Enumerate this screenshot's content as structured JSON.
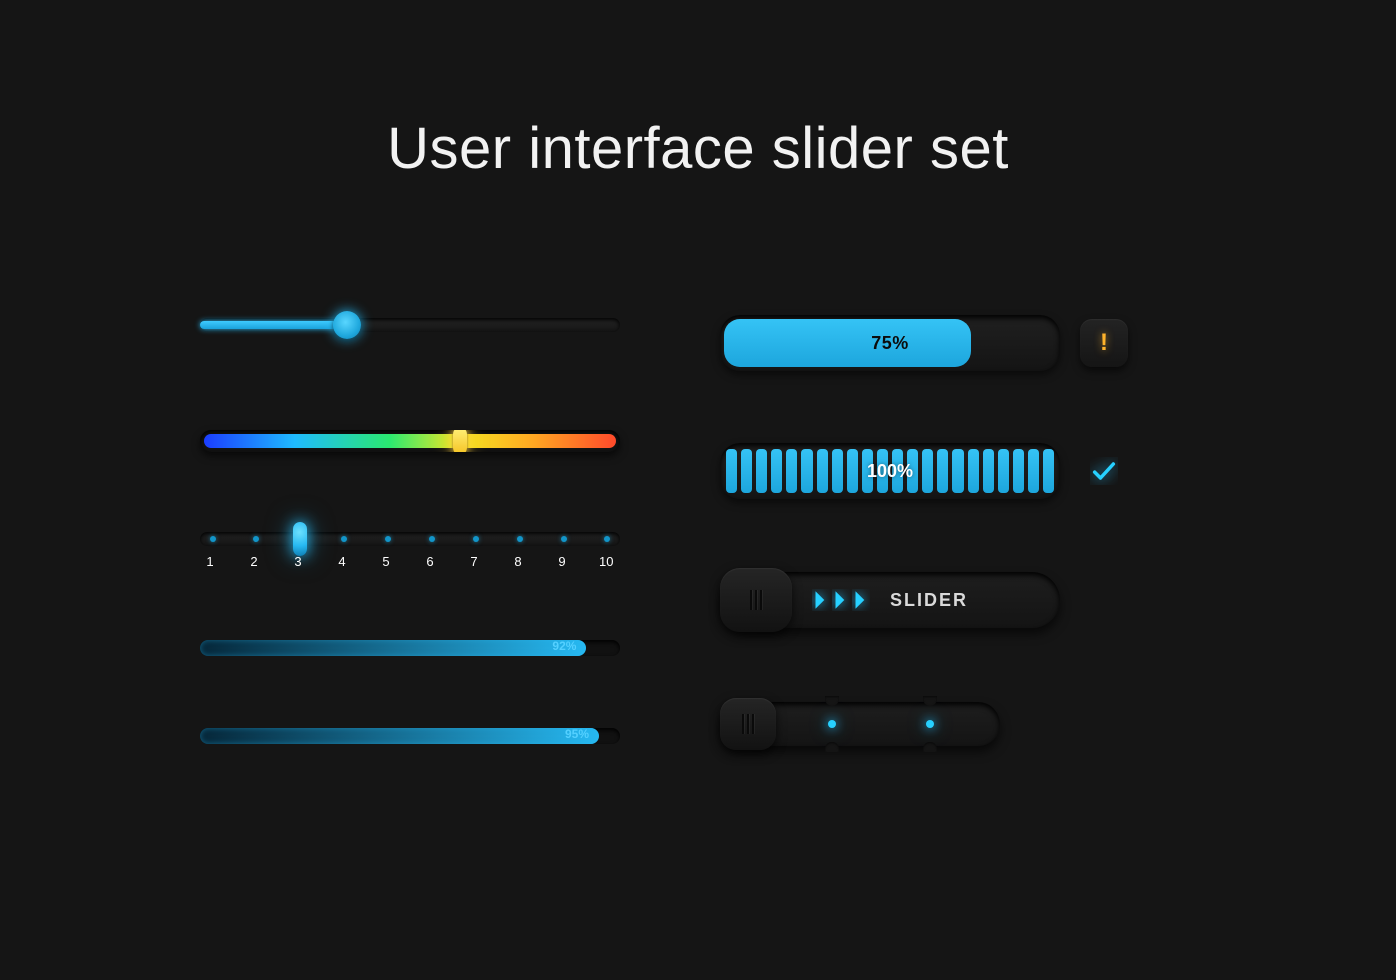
{
  "title": "User interface slider set",
  "colors": {
    "accent": "#27B9F2",
    "warning": "#FFB32B",
    "bg": "#151515"
  },
  "basic_slider": {
    "percent": 35
  },
  "rainbow_slider": {
    "percent": 62
  },
  "step_slider": {
    "steps": [
      "1",
      "2",
      "3",
      "4",
      "5",
      "6",
      "7",
      "8",
      "9",
      "10"
    ],
    "selected_index": 2
  },
  "thin_progress_a": {
    "percent": 92,
    "label": "92%"
  },
  "thin_progress_b": {
    "percent": 95,
    "label": "95%"
  },
  "progress_block": {
    "percent": 75,
    "label": "75%",
    "status_icon": "warning-icon"
  },
  "stripe_block": {
    "percent": 100,
    "label": "100%",
    "segments": 22,
    "status_icon": "check-icon"
  },
  "pull_slider": {
    "label": "SLIDER",
    "chevrons": 3
  },
  "notch_slider": {
    "dots": 2
  }
}
